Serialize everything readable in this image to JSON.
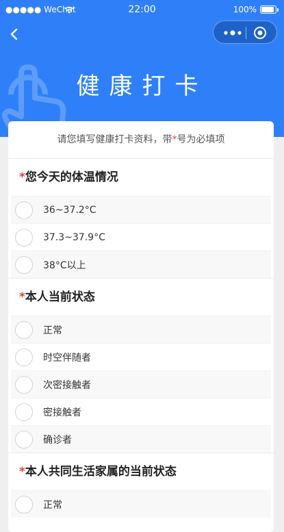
{
  "status_bar": {
    "carrier": "●●●●● WeChat",
    "time": "22:00",
    "battery": "100%"
  },
  "hero": {
    "title": "健康打卡"
  },
  "intro": {
    "before": "请您填写健康打卡资料，带",
    "star": "*",
    "after": "号为必填项"
  },
  "sections": [
    {
      "star": "*",
      "title": "您今天的体温情况",
      "options": [
        "36~37.2°C",
        "37.3~37.9°C",
        "38°C以上"
      ]
    },
    {
      "star": "*",
      "title": "本人当前状态",
      "options": [
        "正常",
        "时空伴随者",
        "次密接触者",
        "密接触者",
        "确诊者"
      ]
    },
    {
      "star": "*",
      "title": "本人共同生活家属的当前状态",
      "options": [
        "正常"
      ]
    }
  ]
}
